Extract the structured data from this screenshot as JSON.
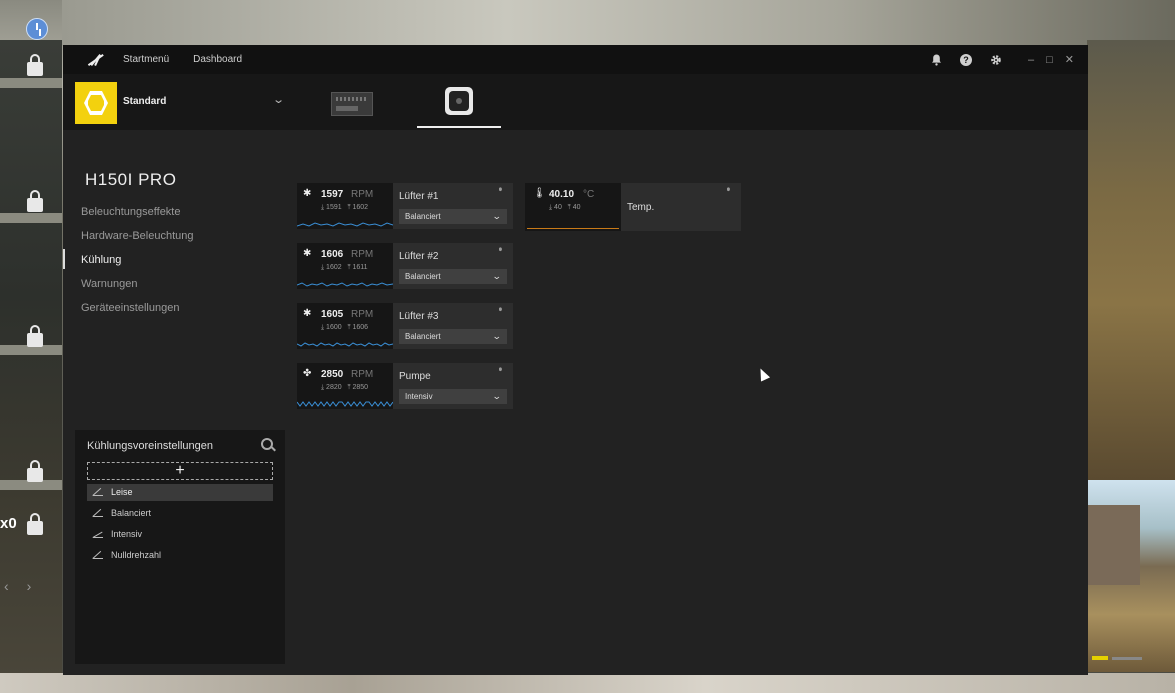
{
  "background": {
    "overlay_text": "x0"
  },
  "app": {
    "nav": {
      "home": "Startmenü",
      "dashboard": "Dashboard"
    },
    "window_controls": {
      "minimize": "–",
      "maximize": "□",
      "close": "✕"
    }
  },
  "profile": {
    "name": "Standard"
  },
  "device": {
    "title": "H150I PRO",
    "menu": [
      {
        "label": "Beleuchtungseffekte"
      },
      {
        "label": "Hardware-Beleuchtung"
      },
      {
        "label": "Kühlung"
      },
      {
        "label": "Warnungen"
      },
      {
        "label": "Geräteeinstellungen"
      }
    ],
    "active_menu": "Kühlung"
  },
  "presets": {
    "title": "Kühlungsvoreinstellungen",
    "add": "+",
    "items": [
      {
        "label": "Leise",
        "selected": true
      },
      {
        "label": "Balanciert",
        "selected": false
      },
      {
        "label": "Intensiv",
        "selected": false
      },
      {
        "label": "Nulldrehzahl",
        "selected": false
      }
    ]
  },
  "fans": [
    {
      "name": "Lüfter #1",
      "rpm": "1597",
      "unit": "RPM",
      "min": "1591",
      "max": "1602",
      "mode": "Balanciert",
      "icon": "fan-icon"
    },
    {
      "name": "Lüfter #2",
      "rpm": "1606",
      "unit": "RPM",
      "min": "1602",
      "max": "1611",
      "mode": "Balanciert",
      "icon": "fan-icon"
    },
    {
      "name": "Lüfter #3",
      "rpm": "1605",
      "unit": "RPM",
      "min": "1600",
      "max": "1606",
      "mode": "Balanciert",
      "icon": "fan-icon"
    },
    {
      "name": "Pumpe",
      "rpm": "2850",
      "unit": "RPM",
      "min": "2820",
      "max": "2850",
      "mode": "Intensiv",
      "icon": "pump-icon"
    }
  ],
  "temperature": {
    "name": "Temp.",
    "value": "40.10",
    "unit": "°C",
    "min": "40",
    "max": "40",
    "line_color": "#c87a18"
  },
  "colors": {
    "accent": "#f3d10e",
    "graph": "#3a8fd6"
  }
}
